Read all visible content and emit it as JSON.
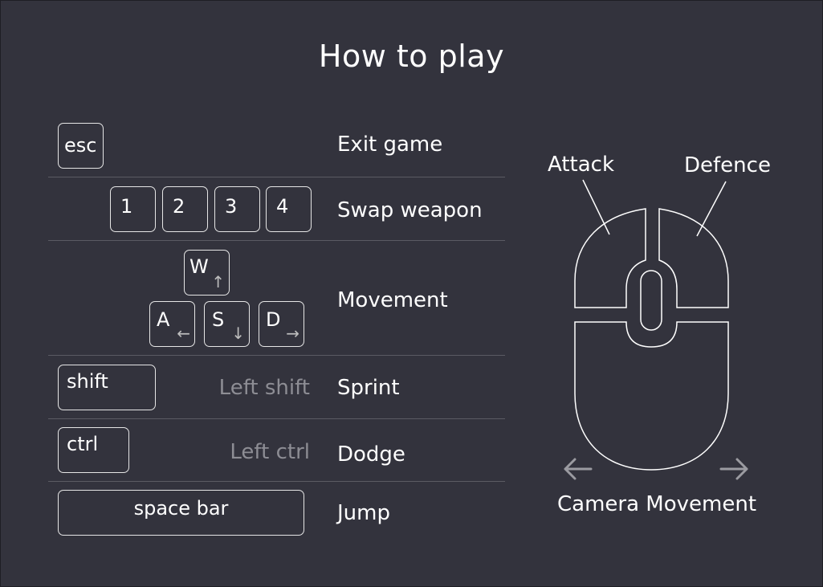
{
  "title": "How to play",
  "controls": {
    "exit": {
      "key": "esc",
      "action": "Exit game"
    },
    "swap": {
      "keys": [
        "1",
        "2",
        "3",
        "4"
      ],
      "action": "Swap weapon"
    },
    "movement": {
      "keys": [
        {
          "label": "W",
          "arrow": "↑"
        },
        {
          "label": "A",
          "arrow": "←"
        },
        {
          "label": "S",
          "arrow": "↓"
        },
        {
          "label": "D",
          "arrow": "→"
        }
      ],
      "action": "Movement"
    },
    "sprint": {
      "key": "shift",
      "hint": "Left shift",
      "action": "Sprint"
    },
    "dodge": {
      "key": "ctrl",
      "hint": "Left ctrl",
      "action": "Dodge"
    },
    "jump": {
      "key": "space bar",
      "action": "Jump"
    }
  },
  "mouse": {
    "left_label": "Attack",
    "right_label": "Defence",
    "move_label": "Camera Movement",
    "left_arrow_icon": "arrow-left-icon",
    "right_arrow_icon": "arrow-right-icon"
  },
  "colors": {
    "background": "#33333d",
    "text": "#ffffff",
    "hint": "#8d8d94",
    "divider": "#5b5b63"
  }
}
